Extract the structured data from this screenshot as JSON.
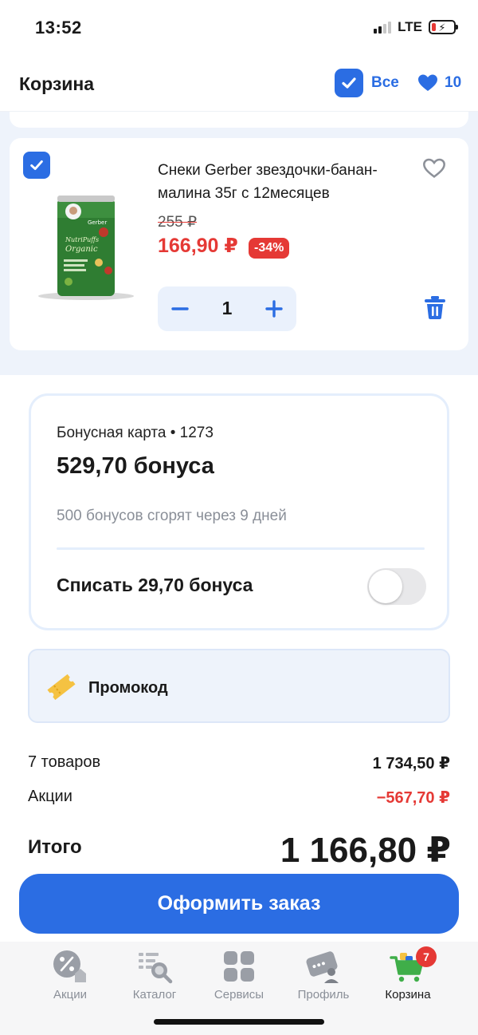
{
  "status_bar": {
    "time": "13:52",
    "network": "LTE"
  },
  "header": {
    "title": "Корзина",
    "select_all_label": "Все",
    "favorites_count": "10"
  },
  "item": {
    "name": "Снеки Gerber звездочки-банан-малина 35г с 12месяцев",
    "old_price": "255 ₽",
    "new_price": "166,90 ₽",
    "discount": "-34%",
    "quantity": "1"
  },
  "bonus": {
    "card_label": "Бонусная карта • 1273",
    "amount": "529,70 бонуса",
    "expire_note": "500 бонусов сгорят через 9 дней",
    "use_label": "Списать 29,70 бонуса",
    "use_enabled": false
  },
  "promo": {
    "label": "Промокод"
  },
  "summary": {
    "items_label": "7 товаров",
    "items_value": "1 734,50 ₽",
    "promo_label": "Акции",
    "promo_value": "−567,70 ₽",
    "total_label": "Итого",
    "total_value": "1 166,80 ₽"
  },
  "checkout_label": "Оформить заказ",
  "tabs": [
    {
      "label": "Акции",
      "icon": "percent-icon"
    },
    {
      "label": "Каталог",
      "icon": "catalog-search-icon"
    },
    {
      "label": "Сервисы",
      "icon": "services-grid-icon"
    },
    {
      "label": "Профиль",
      "icon": "profile-card-icon"
    },
    {
      "label": "Корзина",
      "icon": "cart-icon",
      "badge": "7"
    }
  ],
  "colors": {
    "accent": "#2b6de3",
    "sale": "#e53935",
    "surface": "#eef3fb"
  }
}
